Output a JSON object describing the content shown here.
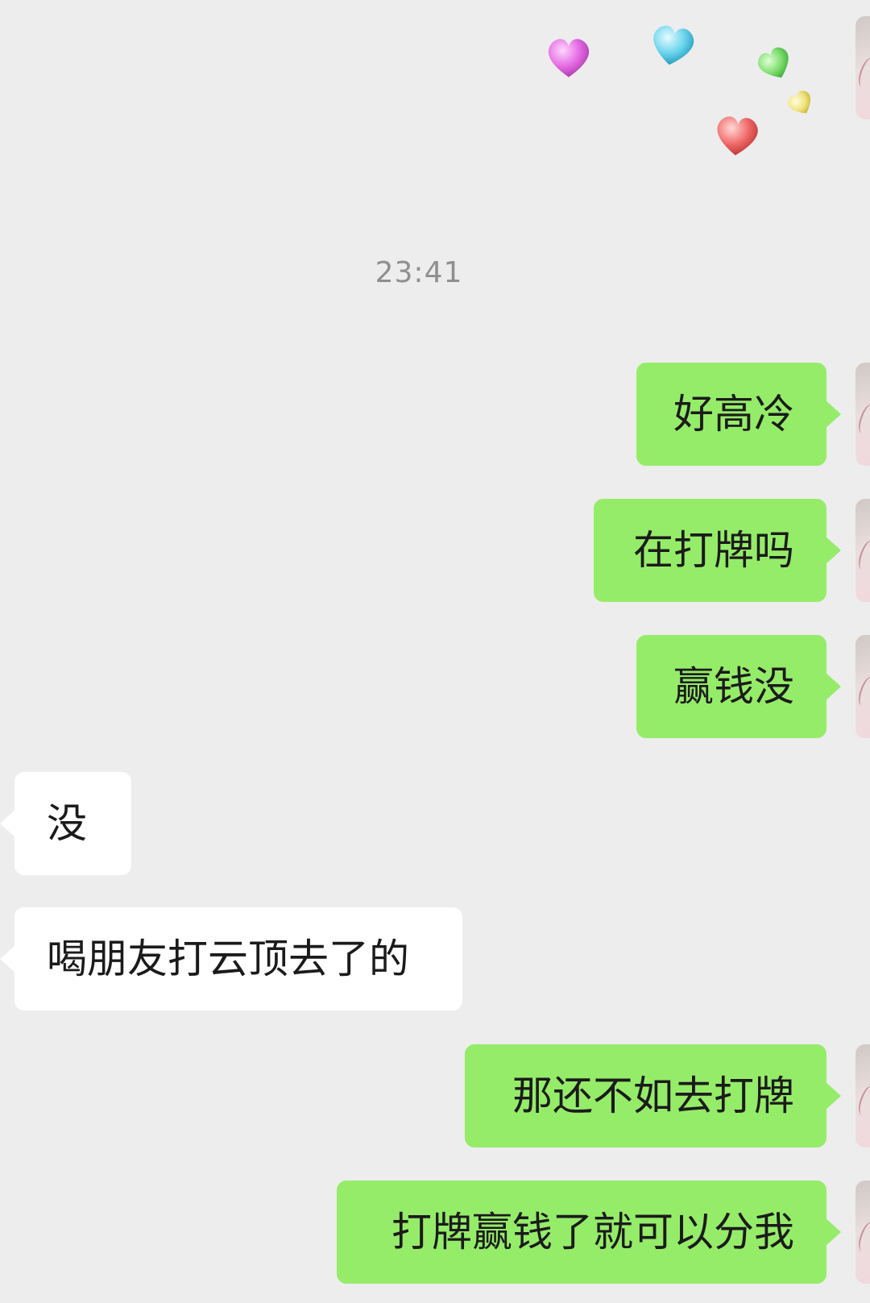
{
  "timestamp": "23:41",
  "messages": [
    {
      "sender": "me",
      "text": "好高冷"
    },
    {
      "sender": "me",
      "text": "在打牌吗"
    },
    {
      "sender": "me",
      "text": "赢钱没"
    },
    {
      "sender": "them",
      "text": "没"
    },
    {
      "sender": "them",
      "text": "喝朋友打云顶去了的"
    },
    {
      "sender": "me",
      "text": "那还不如去打牌"
    },
    {
      "sender": "me",
      "text": "打牌赢钱了就可以分我"
    }
  ],
  "colors": {
    "background": "#ededed",
    "my_bubble": "#95ec69",
    "their_bubble": "#ffffff",
    "timestamp_text": "#8f8f8f"
  },
  "stickers": [
    {
      "icon": "heart-icon",
      "color": "#e46be3"
    },
    {
      "icon": "heart-icon",
      "color": "#6ad4ec"
    },
    {
      "icon": "heart-icon",
      "color": "#7fdd6f"
    },
    {
      "icon": "heart-icon",
      "color": "#f0e37d"
    },
    {
      "icon": "heart-icon",
      "color": "#f06a6a"
    }
  ]
}
